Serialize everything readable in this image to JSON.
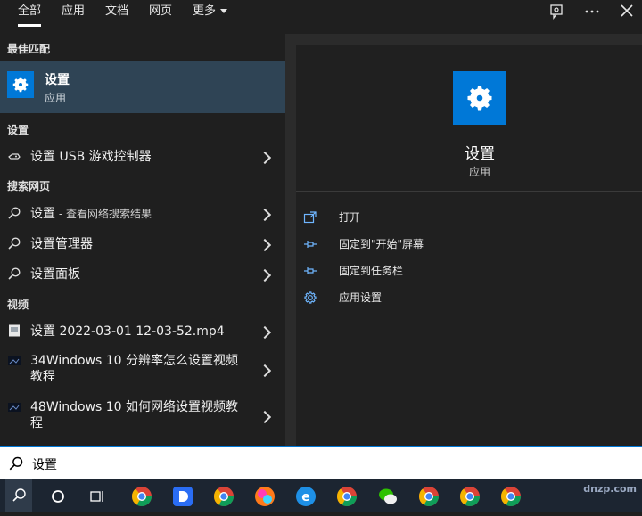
{
  "tabs": [
    {
      "label": "全部",
      "active": true
    },
    {
      "label": "应用"
    },
    {
      "label": "文档"
    },
    {
      "label": "网页"
    },
    {
      "label": "更多"
    }
  ],
  "top_icons": [
    "feedback-icon",
    "more-icon",
    "close-icon"
  ],
  "best_match": {
    "heading": "最佳匹配",
    "title": "设置",
    "subtitle": "应用"
  },
  "sections": {
    "settings": "设置",
    "web": "搜索网页",
    "video": "视频"
  },
  "settings_items": [
    {
      "label": "设置 USB 游戏控制器"
    }
  ],
  "web_items": [
    {
      "label": "设置",
      "suffix": " - 查看网络搜索结果"
    },
    {
      "label": "设置管理器"
    },
    {
      "label": "设置面板"
    }
  ],
  "video_items": [
    {
      "label": "设置 2022-03-01 12-03-52.mp4"
    },
    {
      "label_line1": "34Windows 10 分辨率怎么设置视频",
      "label_line2": "教程"
    },
    {
      "label_line1": "48Windows 10 如何网络设置视频教",
      "label_line2": "程"
    }
  ],
  "detail": {
    "title": "设置",
    "subtitle": "应用",
    "actions": [
      {
        "label": "打开",
        "icon": "open-icon"
      },
      {
        "label": "固定到\"开始\"屏幕",
        "icon": "pin-icon"
      },
      {
        "label": "固定到任务栏",
        "icon": "pin-icon"
      },
      {
        "label": "应用设置",
        "icon": "gear-icon"
      }
    ]
  },
  "search": {
    "value": "设置"
  },
  "colors": {
    "accent": "#0078d7",
    "highlight": "#2f4455",
    "taskbar": "#1c2531"
  },
  "watermark": "dnzp.com"
}
